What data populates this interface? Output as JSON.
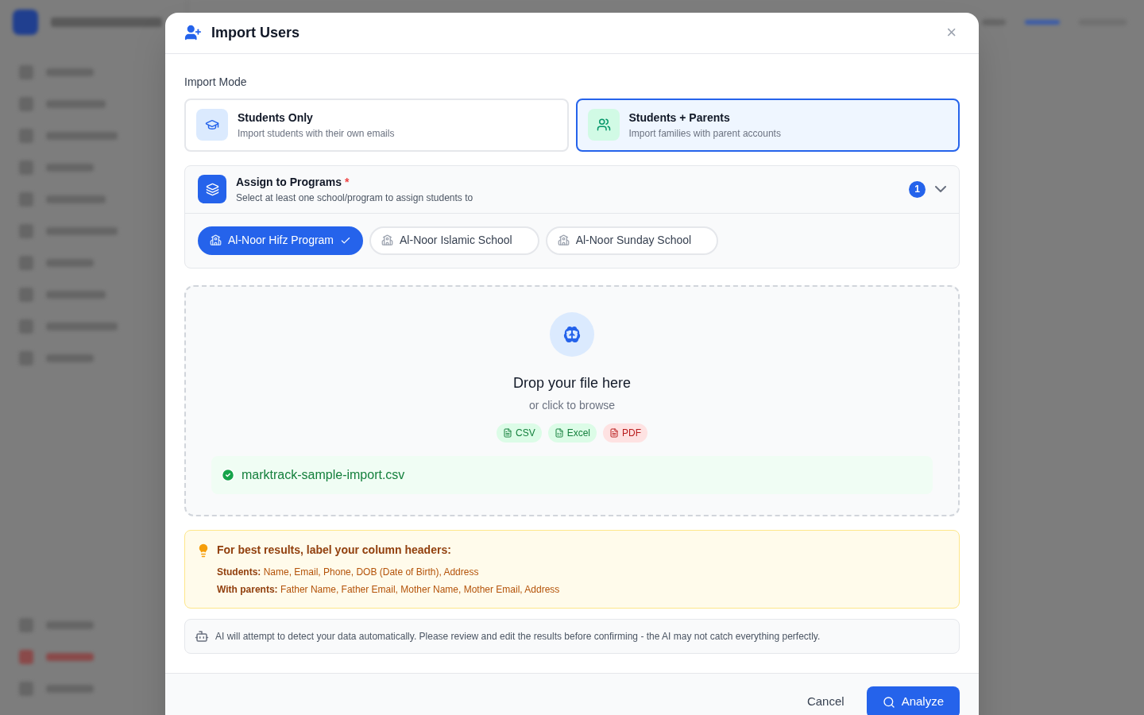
{
  "dialog": {
    "title": "Import Users",
    "close": "×"
  },
  "import_mode": {
    "label": "Import Mode",
    "options": [
      {
        "kind": "students",
        "title": "Students Only",
        "subtitle": "Import students with their own emails",
        "selected": false
      },
      {
        "kind": "families",
        "title": "Students + Parents",
        "subtitle": "Import families with parent accounts",
        "selected": true
      }
    ]
  },
  "programs": {
    "title": "Assign to Programs",
    "required": "*",
    "subtitle": "Select at least one school/program to assign students to",
    "count": "1",
    "expanded": true,
    "items": [
      {
        "label": "Al-Noor Hifz Program",
        "selected": true
      },
      {
        "label": "Al-Noor Islamic School",
        "selected": false
      },
      {
        "label": "Al-Noor Sunday School",
        "selected": false
      }
    ]
  },
  "dropzone": {
    "title": "Drop your file here",
    "subtitle": "or click to browse",
    "formats": [
      {
        "label": "CSV",
        "color": "#15803d"
      },
      {
        "label": "Excel",
        "color": "#15803d"
      },
      {
        "label": "PDF",
        "color": "#b91c1c"
      }
    ],
    "file": "marktrack-sample-import.csv"
  },
  "tip": {
    "title": "For best results, label your column headers:",
    "lines": [
      "**Students:** Name, Email, Phone, DOB (Date of Birth), Address",
      "**With parents:** Father Name, Father Email, Mother Name, Mother Email, Address"
    ]
  },
  "ai_note": "AI will attempt to detect your data automatically. Please review and edit the results before confirming - the AI may not catch everything perfectly.",
  "footer": {
    "cancel": "Cancel",
    "submit": "Analyze"
  }
}
